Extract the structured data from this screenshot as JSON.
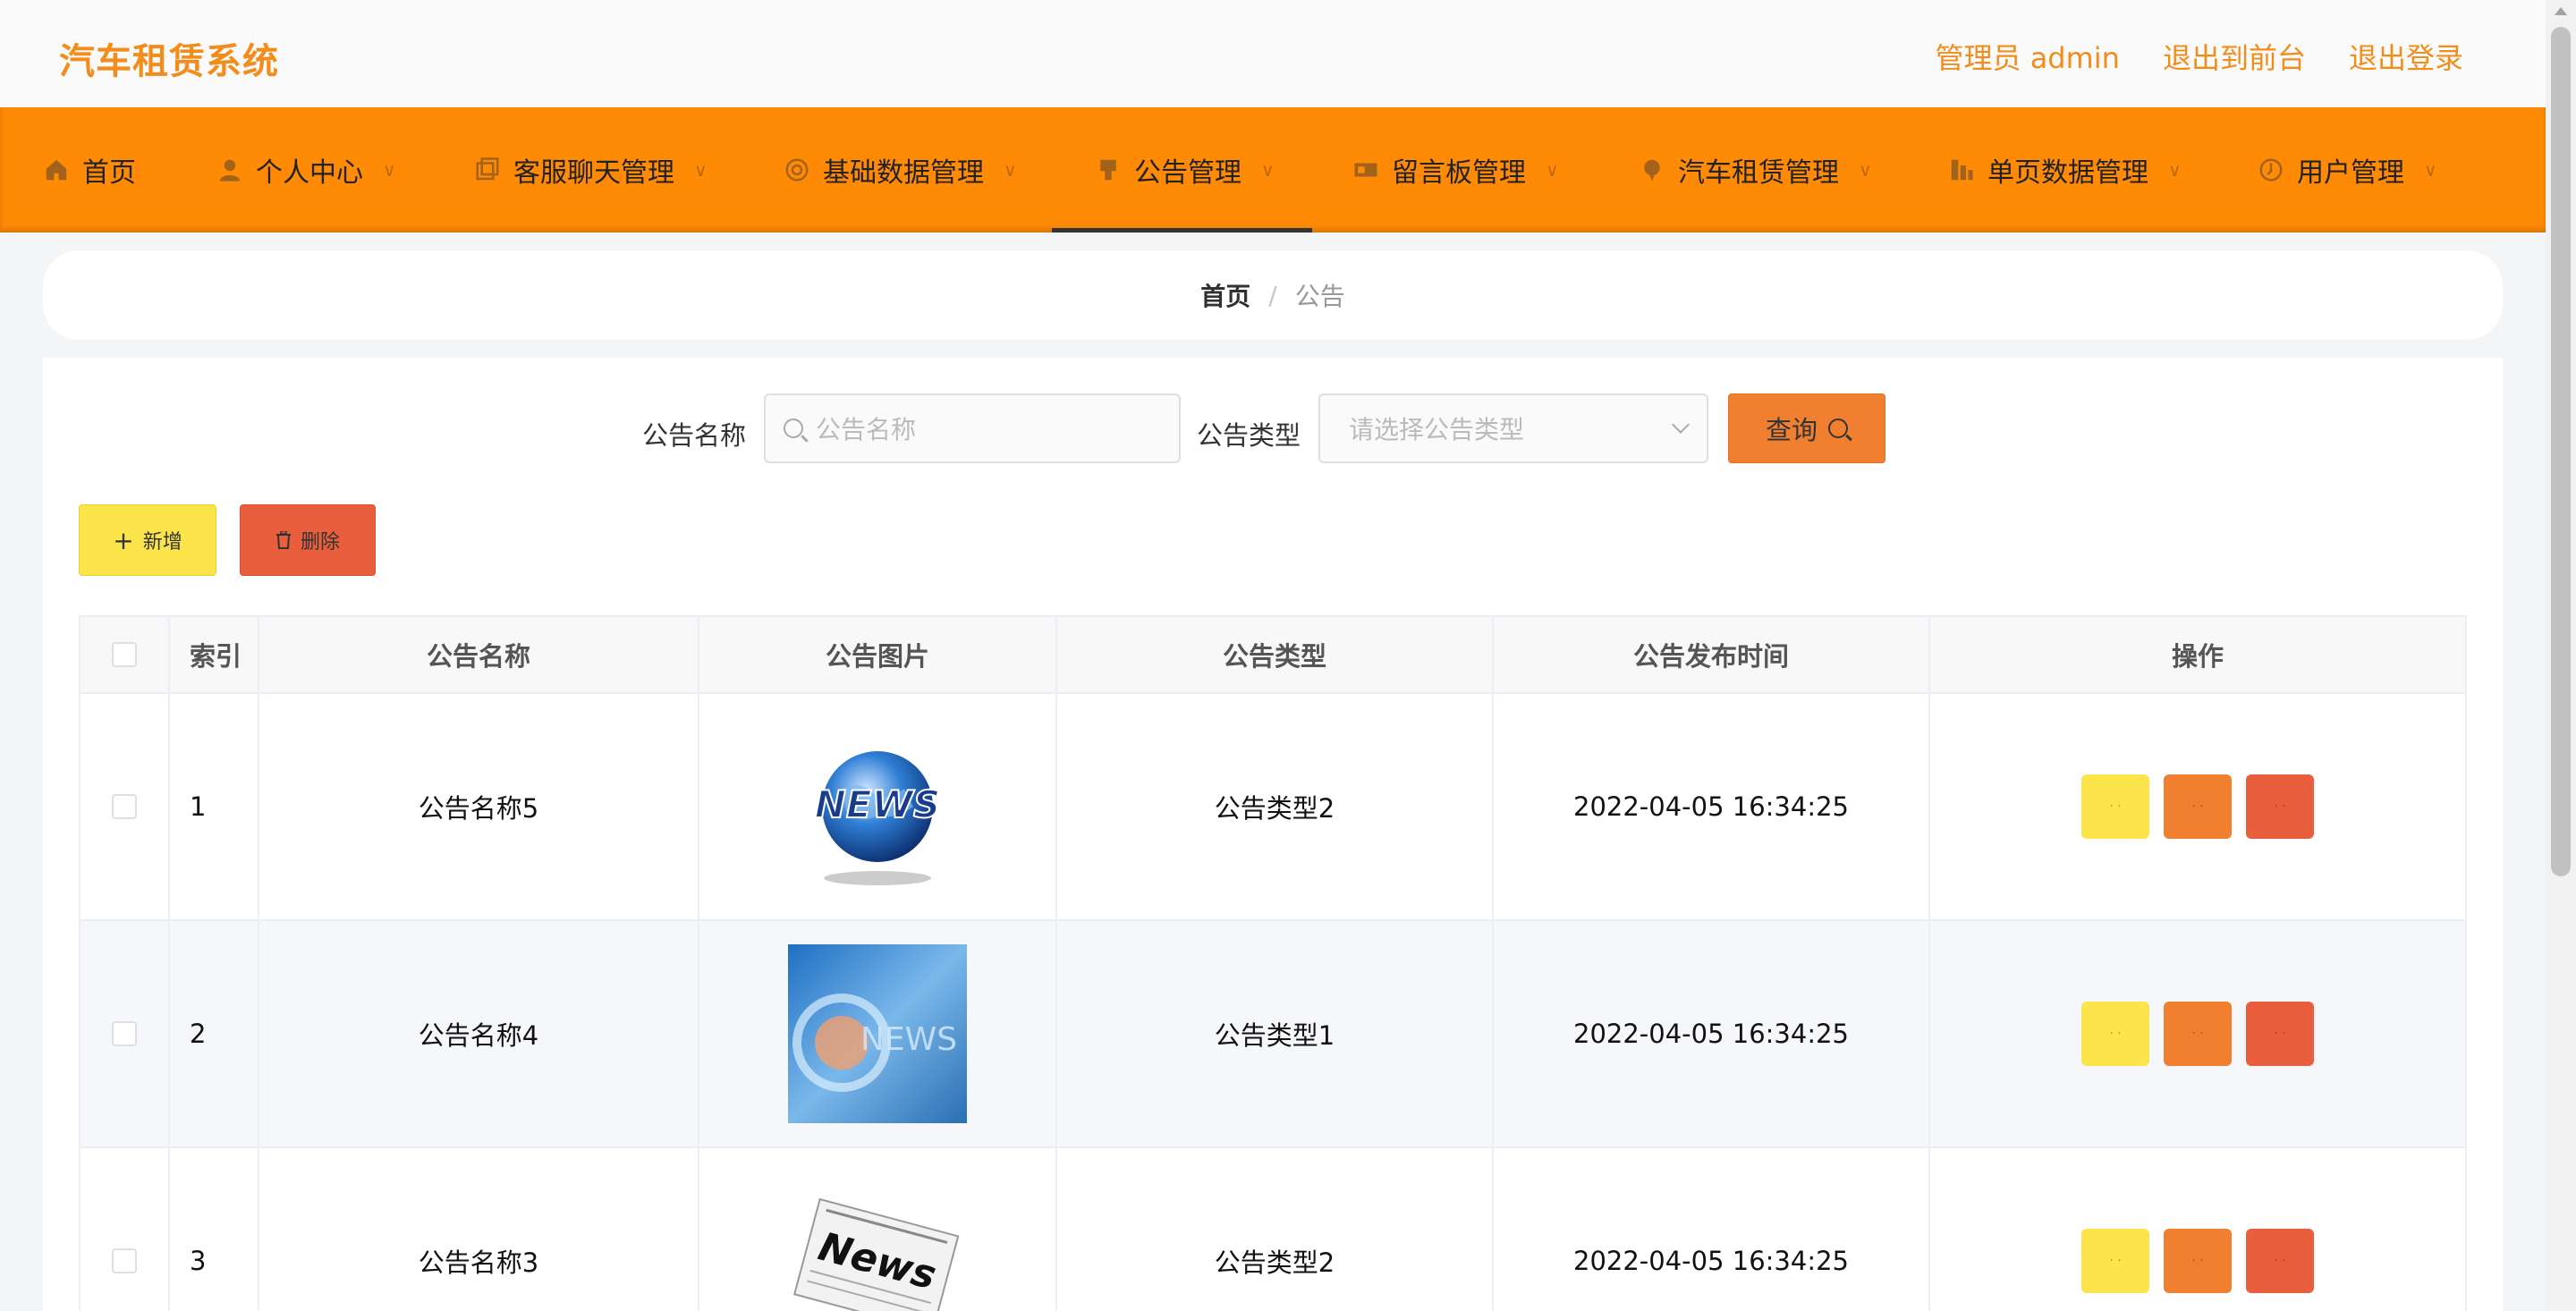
{
  "app": {
    "title": "汽车租赁系统"
  },
  "header": {
    "links": [
      "管理员 admin",
      "退出到前台",
      "退出登录"
    ]
  },
  "nav": {
    "items": [
      {
        "label": "首页",
        "icon": "home-icon"
      },
      {
        "label": "个人中心",
        "icon": "user-icon"
      },
      {
        "label": "客服聊天管理",
        "icon": "chat-icon"
      },
      {
        "label": "基础数据管理",
        "icon": "database-icon"
      },
      {
        "label": "公告管理",
        "icon": "notice-icon",
        "active": true
      },
      {
        "label": "留言板管理",
        "icon": "message-board-icon"
      },
      {
        "label": "汽车租赁管理",
        "icon": "car-icon"
      },
      {
        "label": "单页数据管理",
        "icon": "page-icon"
      },
      {
        "label": "用户管理",
        "icon": "users-icon"
      }
    ]
  },
  "breadcrumb": {
    "home": "首页",
    "current": "公告"
  },
  "search": {
    "name_label": "公告名称",
    "name_placeholder": "公告名称",
    "type_label": "公告类型",
    "type_placeholder": "请选择公告类型",
    "query_label": "查询"
  },
  "actions": {
    "add_label": "新增",
    "delete_label": "删除"
  },
  "table": {
    "columns": [
      "索引",
      "公告名称",
      "公告图片",
      "公告类型",
      "公告发布时间",
      "操作"
    ],
    "rows": [
      {
        "index": "1",
        "name": "公告名称5",
        "image": "news-globe",
        "type": "公告类型2",
        "time": "2022-04-05 16:34:25"
      },
      {
        "index": "2",
        "name": "公告名称4",
        "image": "news-blue",
        "type": "公告类型1",
        "time": "2022-04-05 16:34:25"
      },
      {
        "index": "3",
        "name": "公告名称3",
        "image": "news-paper",
        "type": "公告类型2",
        "time": "2022-04-05 16:34:25"
      }
    ],
    "op_labels": [
      "· ·",
      "· ·",
      "· ·"
    ]
  },
  "colors": {
    "accent": "#fe8a06",
    "brand_text": "#f28d1c",
    "yellow": "#fbe54a",
    "orange": "#f0802f",
    "red": "#e95e3d"
  }
}
